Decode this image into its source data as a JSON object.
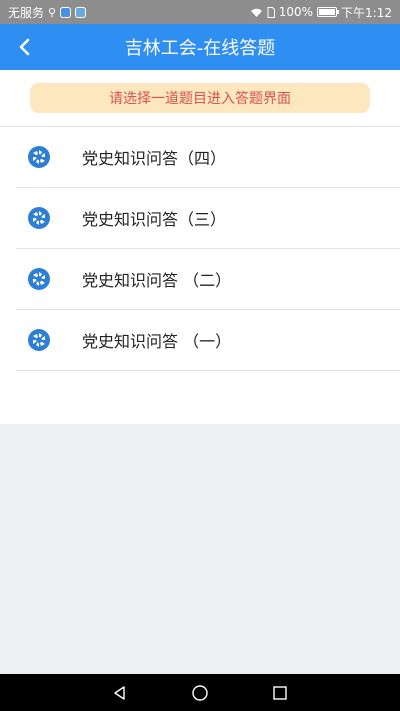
{
  "status_bar": {
    "carrier": "无服务",
    "battery_percent": "100%",
    "battery_level": 1.0,
    "time": "下午1:12"
  },
  "header": {
    "title": "吉林工会-在线答题",
    "back_icon": "chevron-left-icon"
  },
  "notice": {
    "text": "请选择一道题目进入答题界面"
  },
  "quiz_list": {
    "items": [
      {
        "label": "党史知识问答（四）"
      },
      {
        "label": "党史知识问答（三）"
      },
      {
        "label": "党史知识问答 （二）"
      },
      {
        "label": "党史知识问答 （一）"
      }
    ]
  },
  "colors": {
    "accent": "#2e8ef2",
    "notice_bg": "#fde7be",
    "notice_text": "#d9534f",
    "icon_blue": "#2d7fd6"
  }
}
